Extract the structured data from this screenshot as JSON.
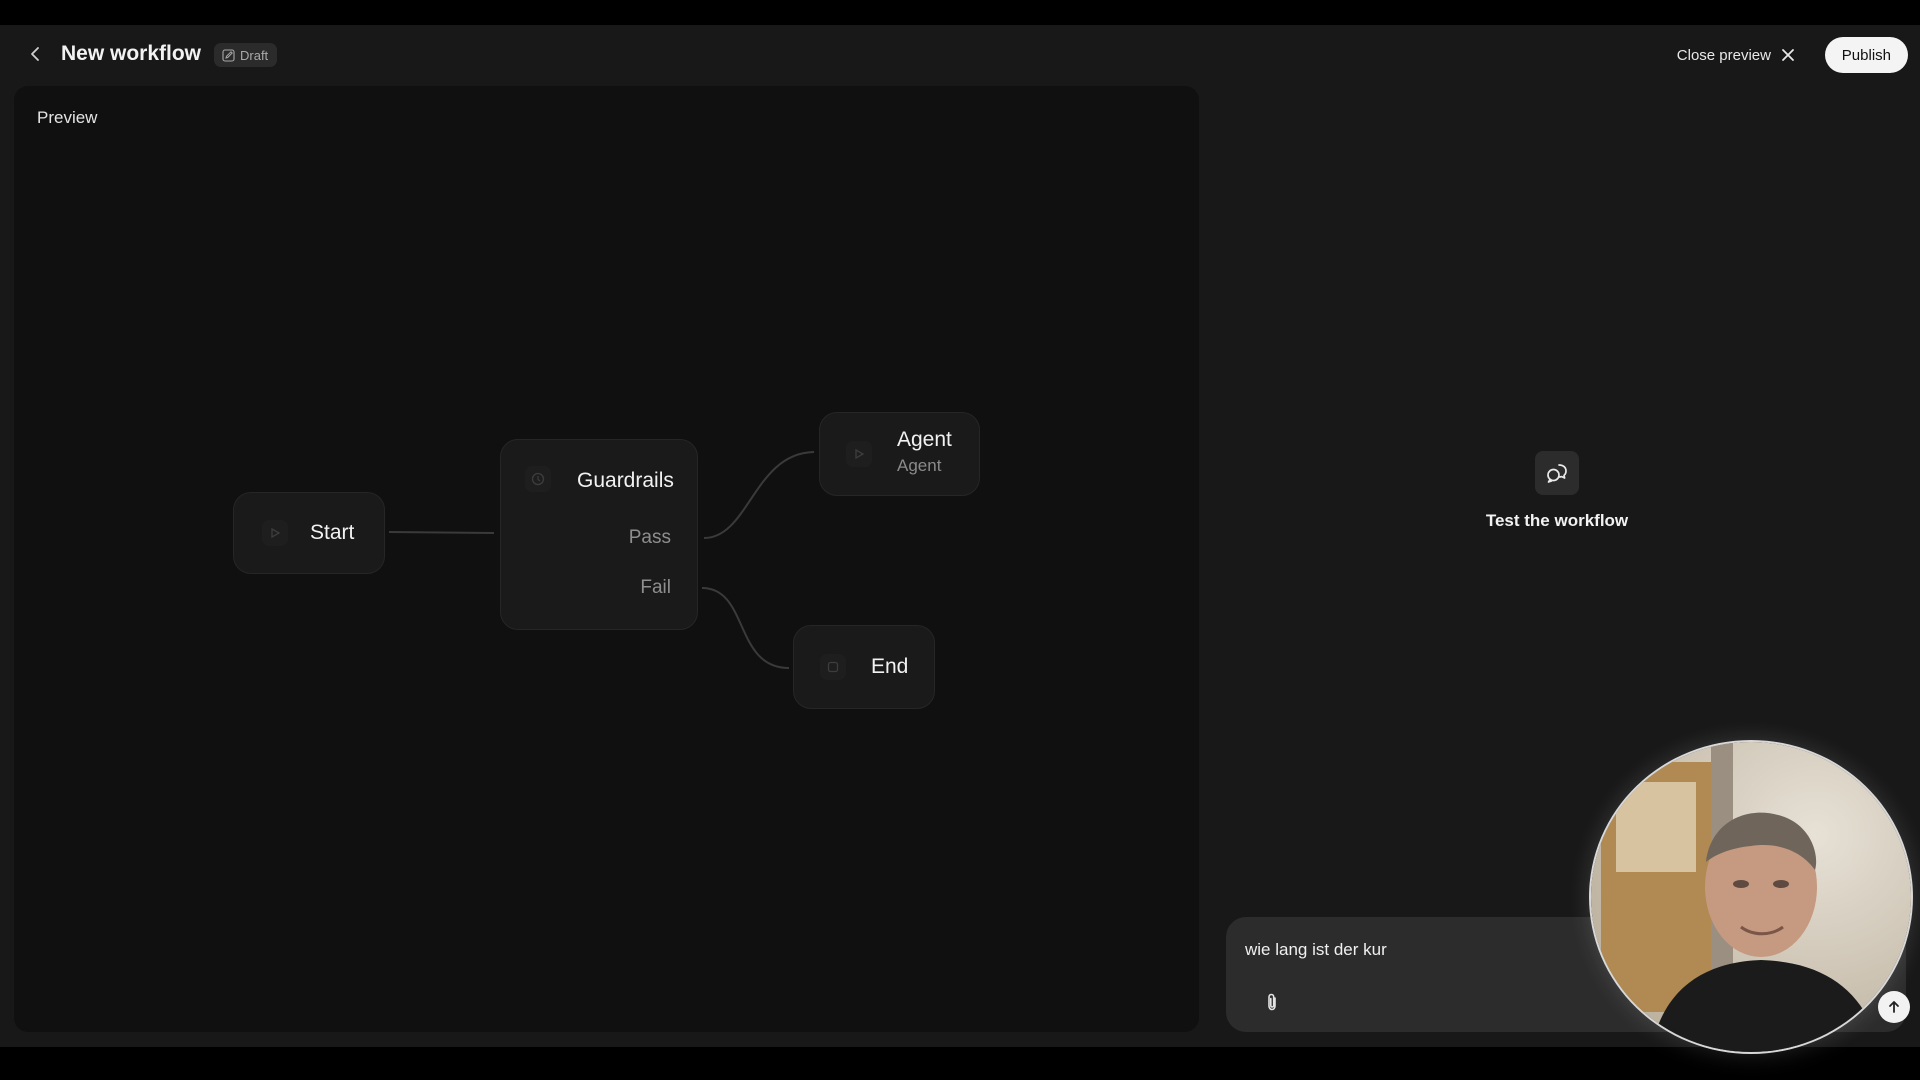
{
  "header": {
    "title": "New workflow",
    "draft_badge": "Draft",
    "close_preview_label": "Close preview",
    "publish_label": "Publish"
  },
  "preview": {
    "label": "Preview",
    "nodes": {
      "start": {
        "title": "Start"
      },
      "guardrails": {
        "title": "Guardrails",
        "branches": [
          "Pass",
          "Fail"
        ]
      },
      "agent": {
        "title": "Agent",
        "subtitle": "Agent"
      },
      "end": {
        "title": "End"
      }
    }
  },
  "test_panel": {
    "title": "Test the workflow",
    "chat_input_value": "wie lang ist der kur"
  },
  "icons": [
    "chevron-left-icon",
    "pencil-icon",
    "close-icon",
    "play-icon",
    "shield-icon",
    "stop-icon",
    "chat-bubbles-icon",
    "paperclip-icon",
    "send-arrow-icon"
  ],
  "colors": {
    "background": "#181818",
    "canvas": "#101010",
    "node": "#1a1a1a",
    "publish_button": "#f4f4f4"
  }
}
